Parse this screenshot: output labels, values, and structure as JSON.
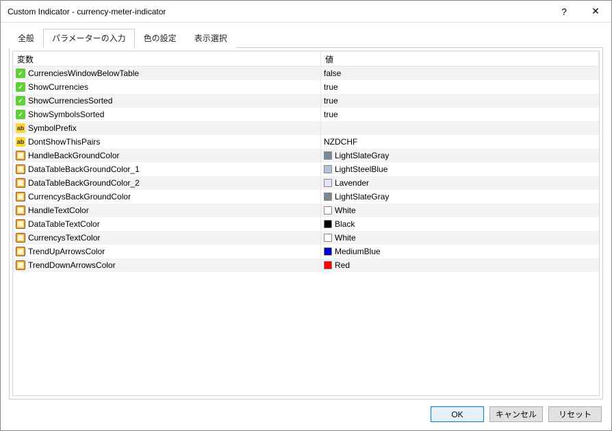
{
  "window": {
    "title": "Custom Indicator - currency-meter-indicator",
    "help_label": "?",
    "close_label": "✕"
  },
  "tabs": [
    {
      "label": "全般"
    },
    {
      "label": "パラメーターの入力"
    },
    {
      "label": "色の設定"
    },
    {
      "label": "表示選択"
    }
  ],
  "active_tab_index": 1,
  "columns": {
    "variable": "変数",
    "value": "値"
  },
  "rows": [
    {
      "type": "bool",
      "name": "CurrenciesWindowBelowTable",
      "value": "false"
    },
    {
      "type": "bool",
      "name": "ShowCurrencies",
      "value": "true"
    },
    {
      "type": "bool",
      "name": "ShowCurrenciesSorted",
      "value": "true"
    },
    {
      "type": "bool",
      "name": "ShowSymbolsSorted",
      "value": "true"
    },
    {
      "type": "str",
      "name": "SymbolPrefix",
      "value": ""
    },
    {
      "type": "str",
      "name": "DontShowThisPairs",
      "value": "NZDCHF"
    },
    {
      "type": "color",
      "name": "HandleBackGroundColor",
      "value": "LightSlateGray",
      "swatch": "#778899"
    },
    {
      "type": "color",
      "name": "DataTableBackGroundColor_1",
      "value": "LightSteelBlue",
      "swatch": "#b0c4de"
    },
    {
      "type": "color",
      "name": "DataTableBackGroundColor_2",
      "value": "Lavender",
      "swatch": "#e6e6fa"
    },
    {
      "type": "color",
      "name": "CurrencysBackGroundColor",
      "value": "LightSlateGray",
      "swatch": "#778899"
    },
    {
      "type": "color",
      "name": "HandleTextColor",
      "value": "White",
      "swatch": "#ffffff"
    },
    {
      "type": "color",
      "name": "DataTableTextColor",
      "value": "Black",
      "swatch": "#000000"
    },
    {
      "type": "color",
      "name": "CurrencysTextColor",
      "value": "White",
      "swatch": "#ffffff"
    },
    {
      "type": "color",
      "name": "TrendUpArrowsColor",
      "value": "MediumBlue",
      "swatch": "#0000cd"
    },
    {
      "type": "color",
      "name": "TrendDownArrowsColor",
      "value": "Red",
      "swatch": "#ff0000"
    }
  ],
  "buttons": {
    "ok": "OK",
    "cancel": "キャンセル",
    "reset": "リセット"
  }
}
